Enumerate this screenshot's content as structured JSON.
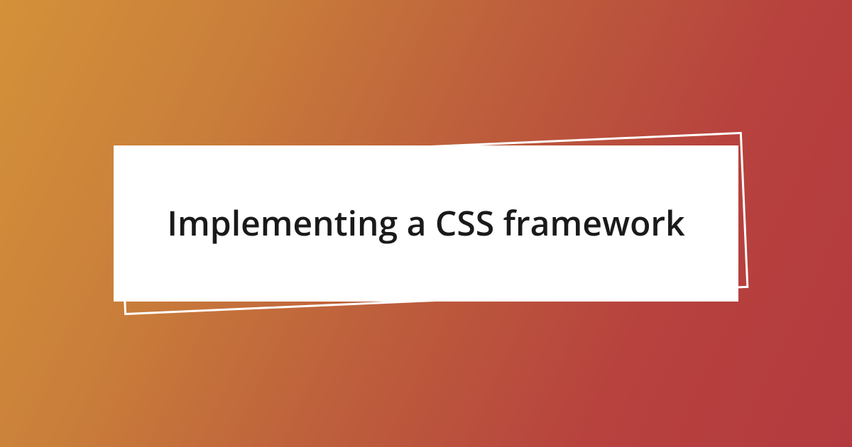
{
  "card": {
    "title": "Implementing a CSS framework"
  }
}
